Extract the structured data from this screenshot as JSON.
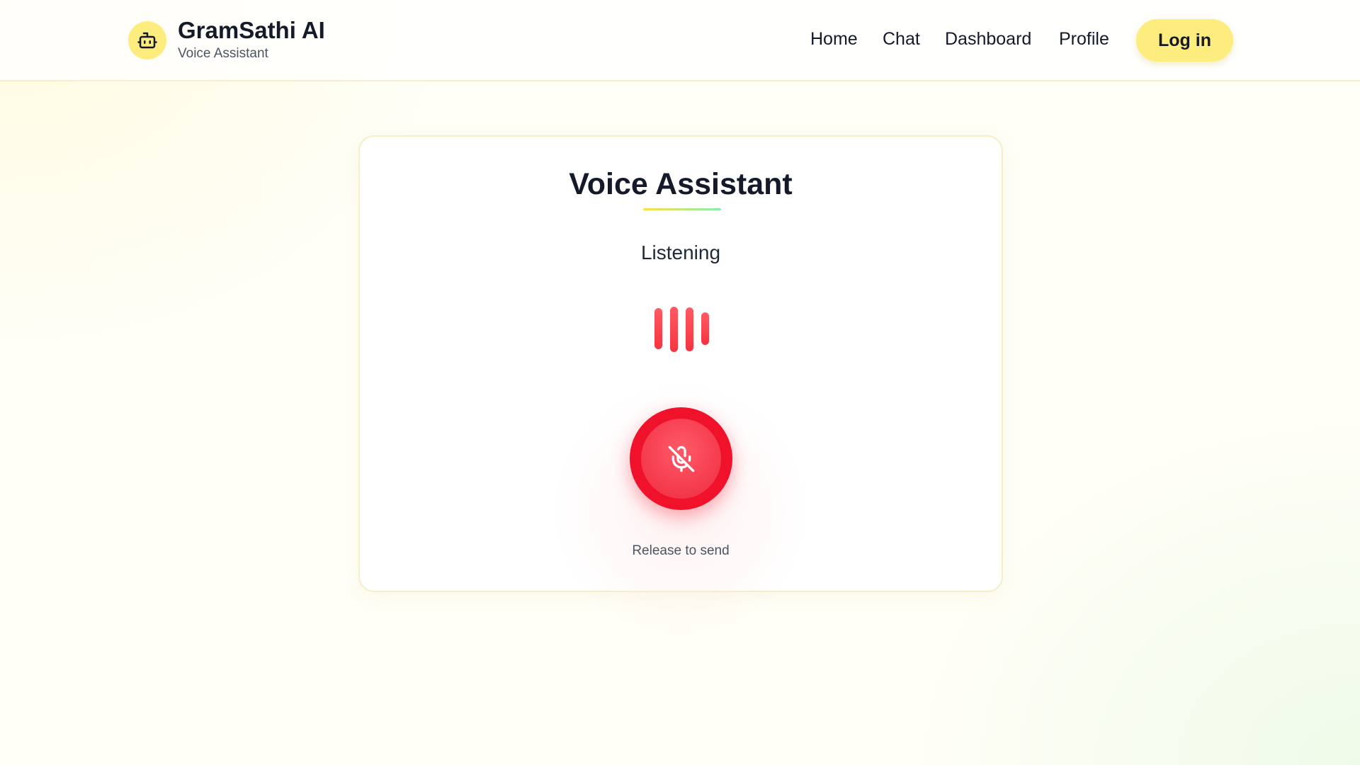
{
  "brand": {
    "title": "GramSathi AI",
    "subtitle": "Voice Assistant",
    "logo_icon": "robot-icon"
  },
  "nav": {
    "links": [
      "Home",
      "Chat",
      "Dashboard",
      "Profile"
    ],
    "login_label": "Log in"
  },
  "card": {
    "title": "Voice Assistant",
    "status": "Listening",
    "mic_icon": "mic-off-icon",
    "hint": "Release to send"
  },
  "colors": {
    "accent_yellow": "#fdec7e",
    "record_red": "#f0112b",
    "text_dark": "#141a2a"
  }
}
